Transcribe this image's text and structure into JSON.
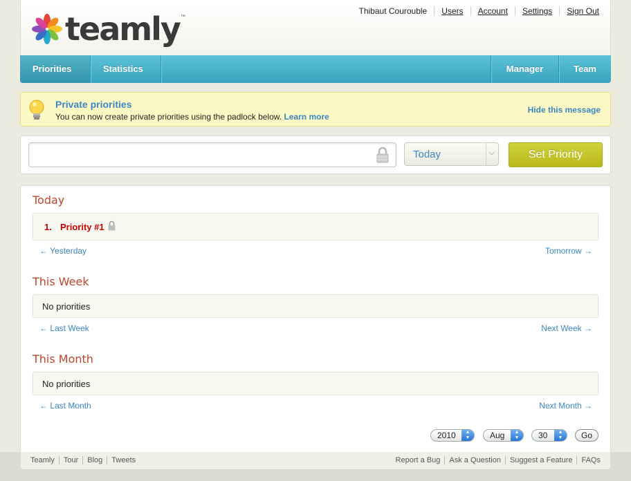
{
  "brand": {
    "name": "teamly",
    "tm": "™"
  },
  "top_links": {
    "user": "Thibaut Courouble",
    "users": "Users",
    "account": "Account",
    "settings": "Settings",
    "sign_out": "Sign Out"
  },
  "nav": {
    "priorities": "Priorities",
    "statistics": "Statistics",
    "manager": "Manager",
    "team": "Team"
  },
  "notice": {
    "title": "Private priorities",
    "text": "You can now create private priorities using the padlock below.",
    "learn_more": "Learn more",
    "hide": "Hide this message"
  },
  "entry": {
    "input_value": "",
    "select_value": "Today",
    "button": "Set Priority"
  },
  "sections": {
    "today": {
      "title": "Today",
      "items": [
        {
          "num": "1.",
          "label": "Priority #1",
          "private": true
        }
      ],
      "prev": "← Yesterday",
      "next": "Tomorrow →"
    },
    "week": {
      "title": "This Week",
      "empty": "No priorities",
      "prev": "← Last Week",
      "next": "Next Week →"
    },
    "month": {
      "title": "This Month",
      "empty": "No priorities",
      "prev": "← Last Month",
      "next": "Next Month →"
    }
  },
  "date_picker": {
    "year": "2010",
    "month": "Aug",
    "day": "30",
    "go": "Go"
  },
  "footer": {
    "left": [
      "Teamly",
      "Tour",
      "Blog",
      "Tweets"
    ],
    "right": [
      "Report a Bug",
      "Ask a Question",
      "Suggest a Feature",
      "FAQs"
    ]
  },
  "colors": {
    "accent_blue": "#3a86c6",
    "nav_teal": "#37a3bd",
    "section_red": "#c0452a",
    "button_olive": "#b7b91c",
    "notice_yellow": "#fdf9c4"
  }
}
